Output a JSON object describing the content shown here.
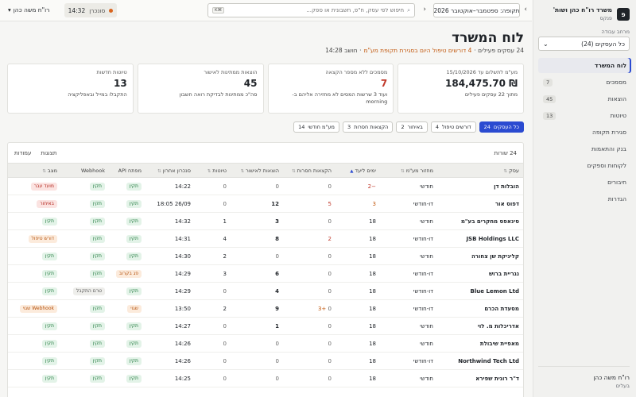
{
  "sidebar": {
    "brand_name": "משרד רו\"ח כהן ושות'",
    "brand_sub": "פנקס",
    "brand_logo": "פ",
    "workspace_label": "מרחב עבודה",
    "workspace_value": "כל העסקים (24)",
    "items": [
      {
        "label": "לוח המשרד",
        "count": "",
        "active": true
      },
      {
        "label": "מסמכים",
        "count": "7"
      },
      {
        "label": "הוצאות",
        "count": "45"
      },
      {
        "label": "טיוטות",
        "count": "13"
      },
      {
        "label": "סגירת תקופה",
        "count": ""
      },
      {
        "label": "בנק והתאמות",
        "count": ""
      },
      {
        "label": "לקוחות וספקים",
        "count": ""
      },
      {
        "label": "חיבורים",
        "count": ""
      },
      {
        "label": "הגדרות",
        "count": ""
      }
    ],
    "user_name": "רו\"ח משה כהן",
    "user_role": "בעלים"
  },
  "topbar": {
    "period": "תקופה: ספטמבר–אוקטובר 2026",
    "search_placeholder": "חיפוש לפי עסק, ח\"פ, חשבונית או ספק...",
    "kbd": "⌘K",
    "sync_time": "14:32",
    "sync_status": "סונכרן",
    "account": "רו\"ח משה כהן",
    "account_chevron": "▾"
  },
  "main": {
    "title": "לוח המשרד",
    "sub_count": "24 עסקים פעילים ·",
    "sub_warn": "4 דורשים טיפול היום בסגירת תקופת מע\"מ",
    "sub_calc": "· חושב 14:28",
    "kpis": [
      {
        "label": "מע\"מ לתשלום עד 15/10/2026",
        "value": "₪ 184,475.70",
        "note": "מתוך 22 עסקים פעילים"
      },
      {
        "label": "מסמכים ללא מספר הקצאה",
        "value": "7",
        "note": "ועוד 3 שרשות המסים לא מחזירה אליהם ב-morning",
        "red": true
      },
      {
        "label": "הוצאות ממתינות לאישור",
        "value": "45",
        "note": "סה\"כ ממתינות לבדיקת רואה חשבון"
      },
      {
        "label": "טיוטות חדשות",
        "value": "13",
        "note": "התקבלו במייל ובאפליקציה"
      }
    ],
    "chips": [
      {
        "label": "כל העסקים",
        "count": "24",
        "active": true
      },
      {
        "label": "דורשים טיפול",
        "count": "4"
      },
      {
        "label": "באיחור",
        "count": "2"
      },
      {
        "label": "הקצאות חסרות",
        "count": "3"
      },
      {
        "label": "מע\"מ חודשי",
        "count": "14"
      }
    ]
  },
  "table": {
    "rows_count": "24 שורות",
    "views_label": "תצוגות",
    "columns_label": "עמודות",
    "headers": [
      "עסק",
      "מחזור מע\"מ",
      "ימים ליעד",
      "הקצאות חסרות",
      "הוצאות לאישור",
      "טיוטות",
      "סנכרון אחרון",
      "מפתח API",
      "Webhook",
      "מצב"
    ],
    "rows": [
      {
        "name": "הובלות דן",
        "cycle": "חודשי",
        "days": "−2",
        "alloc": "0",
        "exp": "0",
        "drafts": "0",
        "sync": "14:22",
        "api": "תקין",
        "webhook": "תקין",
        "status": "מועד עבר"
      },
      {
        "name": "דפוס אור",
        "cycle": "דו-חודשי",
        "days": "3",
        "alloc": "5",
        "exp": "12",
        "drafts": "0",
        "sync": "26/09 18:05",
        "api": "תקין",
        "webhook": "תקין",
        "status": "באיחור"
      },
      {
        "name": "סינאפס מחקרים בע\"מ",
        "cycle": "חודשי",
        "days": "18",
        "alloc": "0",
        "exp": "3",
        "drafts": "1",
        "sync": "14:32",
        "api": "תקין",
        "webhook": "תקין",
        "status": "תקין"
      },
      {
        "name": "JSB Holdings LLC",
        "cycle": "דו-חודשי",
        "days": "18",
        "alloc": "2",
        "exp": "8",
        "drafts": "4",
        "sync": "14:31",
        "api": "תקין",
        "webhook": "תקין",
        "status": "דורש טיפול"
      },
      {
        "name": "קליניקת שן צחורה",
        "cycle": "חודשי",
        "days": "18",
        "alloc": "0",
        "exp": "0",
        "drafts": "2",
        "sync": "14:30",
        "api": "תקין",
        "webhook": "תקין",
        "status": "תקין"
      },
      {
        "name": "נגריית ברוש",
        "cycle": "דו-חודשי",
        "days": "18",
        "alloc": "0",
        "exp": "6",
        "drafts": "3",
        "sync": "14:29",
        "api": "פג בקרוב",
        "webhook": "תקין",
        "status": "תקין"
      },
      {
        "name": "Blue Lemon Ltd",
        "cycle": "דו-חודשי",
        "days": "18",
        "alloc": "0",
        "exp": "4",
        "drafts": "0",
        "sync": "14:29",
        "api": "תקין",
        "webhook": "טרם התקבל",
        "status": "תקין"
      },
      {
        "name": "מסעדת הכרם",
        "cycle": "דו-חודשי",
        "days": "18",
        "alloc": "0",
        "alloc_extra": "+3",
        "exp": "9",
        "drafts": "2",
        "sync": "13:50",
        "api": "שגוי",
        "webhook": "תקין",
        "status": "Webhook שגוי"
      },
      {
        "name": "אדריכלות מ. לוי",
        "cycle": "חודשי",
        "days": "18",
        "alloc": "0",
        "exp": "1",
        "drafts": "0",
        "sync": "14:27",
        "api": "תקין",
        "webhook": "תקין",
        "status": "תקין"
      },
      {
        "name": "מאפיית שיבולת",
        "cycle": "חודשי",
        "days": "18",
        "alloc": "0",
        "exp": "0",
        "drafts": "0",
        "sync": "14:26",
        "api": "תקין",
        "webhook": "תקין",
        "status": "תקין"
      },
      {
        "name": "Northwind Tech Ltd",
        "cycle": "דו-חודשי",
        "days": "18",
        "alloc": "0",
        "exp": "0",
        "drafts": "0",
        "sync": "14:26",
        "api": "תקין",
        "webhook": "תקין",
        "status": "תקין"
      },
      {
        "name": "ד\"ר רונית שפירא",
        "cycle": "חודשי",
        "days": "18",
        "alloc": "0",
        "exp": "0",
        "drafts": "0",
        "sync": "14:25",
        "api": "תקין",
        "webhook": "תקין",
        "status": "תקין"
      }
    ]
  },
  "icons": {
    "search": "search-icon",
    "chevron_prev": "chevron-right-icon",
    "chevron_next": "chevron-left-icon",
    "sort": "sort-icon"
  },
  "colors": {
    "accent": "#2b4bd1",
    "ok_green": "#1f7a3d",
    "warn_orange": "#c2590f",
    "error_red": "#c0392b",
    "sync_dot": "#d9641e"
  }
}
